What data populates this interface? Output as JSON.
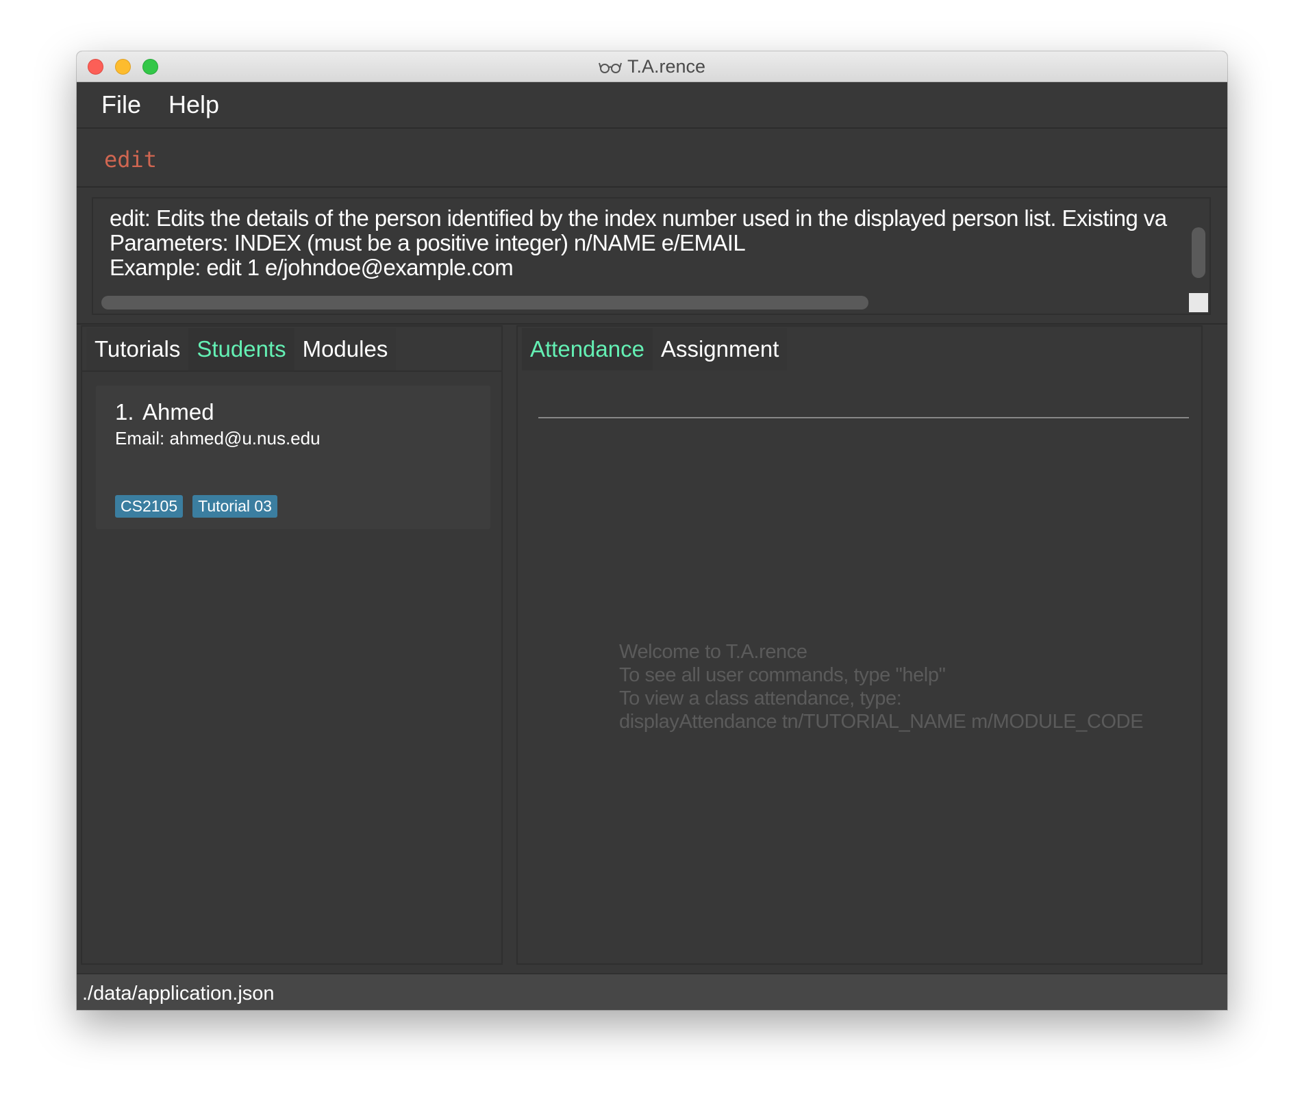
{
  "window": {
    "title": "T.A.rence"
  },
  "menu": {
    "file": "File",
    "help": "Help"
  },
  "command": {
    "value": "edit"
  },
  "result": {
    "lines": [
      "edit: Edits the details of the person identified by the index number used in the displayed person list. Existing va",
      "Parameters: INDEX (must be a positive integer) n/NAME e/EMAIL",
      "Example: edit 1 e/johndoe@example.com"
    ]
  },
  "left_tabs": [
    {
      "label": "Tutorials",
      "active": false
    },
    {
      "label": "Students",
      "active": true
    },
    {
      "label": "Modules",
      "active": false
    }
  ],
  "students": [
    {
      "index": "1.",
      "name": "Ahmed",
      "email": "Email: ahmed@u.nus.edu",
      "tags": [
        "CS2105",
        "Tutorial 03"
      ]
    }
  ],
  "right_tabs": [
    {
      "label": "Attendance",
      "active": true
    },
    {
      "label": "Assignment",
      "active": false
    }
  ],
  "welcome": {
    "line1": "Welcome to T.A.rence",
    "line2": "To see all user commands, type \"help\"",
    "line3": "To view a class attendance, type:",
    "line4": "displayAttendance tn/TUTORIAL_NAME m/MODULE_CODE"
  },
  "status": {
    "path": "./data/application.json"
  },
  "colors": {
    "background": "#383838",
    "accent": "#64f0b4",
    "command_text": "#d06651",
    "tag": "#3b7ea0"
  }
}
